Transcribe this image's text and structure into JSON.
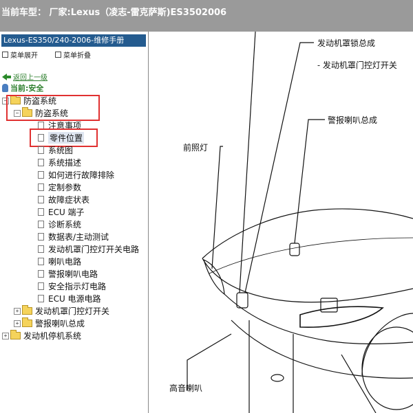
{
  "window": {
    "title": "当前车型： 厂家:Lexus（凌志-雷克萨斯)ES3502006"
  },
  "sidebar": {
    "manual_title": "Lexus-ES350/240-2006-维修手册",
    "expand_label": "菜单展开",
    "collapse_label": "菜单折叠",
    "back_label": "返回上一级",
    "current_label": "当前:安全",
    "tree": {
      "root": "防盗系统",
      "child": "防盗系统",
      "items": [
        "注意事项",
        "零件位置",
        "系统图",
        "系统描述",
        "如何进行故障排除",
        "定制参数",
        "故障症状表",
        "ECU 端子",
        "诊断系统",
        "数据表/主动测试",
        "发动机罩门控灯开关电路",
        "喇叭电路",
        "警报喇叭电路",
        "安全指示灯电路",
        "ECU 电源电路"
      ],
      "siblings": [
        "发动机罩门控灯开关",
        "警报喇叭总成"
      ],
      "bottom": "发动机停机系统"
    }
  },
  "diagram": {
    "labels": {
      "hood_lock": "发动机罩锁总成",
      "hood_switch": "- 发动机罩门控灯开关",
      "alarm_horn": "警报喇叭总成",
      "headlight": "前照灯",
      "high_horn": "高音喇叭"
    },
    "colors": {
      "accent": "#245b8f",
      "highlight": "#e03030",
      "titlebar": "#9a9a9a"
    }
  }
}
